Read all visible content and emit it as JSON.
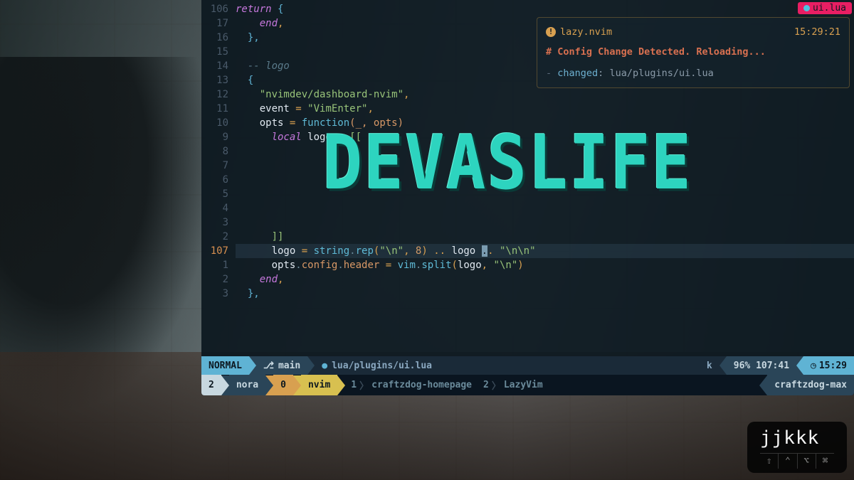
{
  "file_tab": "ui.lua",
  "gutter": [
    "106",
    "17",
    "16",
    "15",
    "14",
    "13",
    "12",
    "11",
    "10",
    "9",
    "8",
    "7",
    "6",
    "5",
    "4",
    "3",
    "2",
    "107",
    "1",
    "2",
    "3"
  ],
  "gutter_current_index": 17,
  "code": {
    "l0_return": "return",
    "l0_brace": " {",
    "l1_end": "end",
    "l1_comma": ",",
    "l2_brace": "},",
    "l4_comment": "-- logo",
    "l5_brace": "{",
    "l6_str": "\"nvimdev/dashboard-nvim\"",
    "l6_comma": ",",
    "l7_event": "event",
    "l7_eq": " = ",
    "l7_str": "\"VimEnter\"",
    "l7_comma": ",",
    "l8_opts": "opts",
    "l8_eq": " = ",
    "l8_fn": "function",
    "l8_args": "(_, opts)",
    "l9_local": "local",
    "l9_logo": " logo ",
    "l9_eq": "= ",
    "l9_bracket": "[[",
    "l16_bracket": "]]",
    "l17_logo": "logo",
    "l17_eq": " = ",
    "l17_string": "string",
    "l17_dot1": ".",
    "l17_rep": "rep",
    "l17_p1": "(",
    "l17_nl": "\"\\n\"",
    "l17_comma": ", ",
    "l17_num": "8",
    "l17_p2": ")",
    "l17_concat": " .. ",
    "l17_logo2": "logo ",
    "l17_concat2": ".. ",
    "l17_nl2": "\"\\n\\n\"",
    "l18_opts": "opts",
    "l18_d1": ".",
    "l18_config": "config",
    "l18_d2": ".",
    "l18_header": "header",
    "l18_eq": " = ",
    "l18_vim": "vim",
    "l18_d3": ".",
    "l18_split": "split",
    "l18_p1": "(",
    "l18_logo": "logo",
    "l18_comma": ", ",
    "l18_nl": "\"\\n\"",
    "l18_p2": ")",
    "l19_end": "end",
    "l19_comma": ",",
    "l20_brace": "},"
  },
  "ascii_logo": "DEVASLIFE",
  "notify": {
    "title": "lazy.nvim",
    "time": "15:29:21",
    "msg": "# Config Change Detected. Reloading...",
    "changed_key": "changed",
    "changed_file": "lua/plugins/ui.lua"
  },
  "status": {
    "mode": "NORMAL",
    "branch_icon": "",
    "branch": "main",
    "file": "lua/plugins/ui.lua",
    "key": "k",
    "percent": "96%",
    "pos": "107:41",
    "clock": "15:29"
  },
  "tmux": {
    "session_idx": "2",
    "session": "nora",
    "active_idx": "0",
    "active_name": "nvim",
    "win1_idx": "1",
    "win1_name": "craftzdog-homepage",
    "win2_idx": "2",
    "win2_name": "LazyVim",
    "host": "craftzdog-max"
  },
  "keycast": {
    "keys": "jjkkk",
    "mods": [
      "⇧",
      "⌃",
      "⌥",
      "⌘"
    ]
  }
}
